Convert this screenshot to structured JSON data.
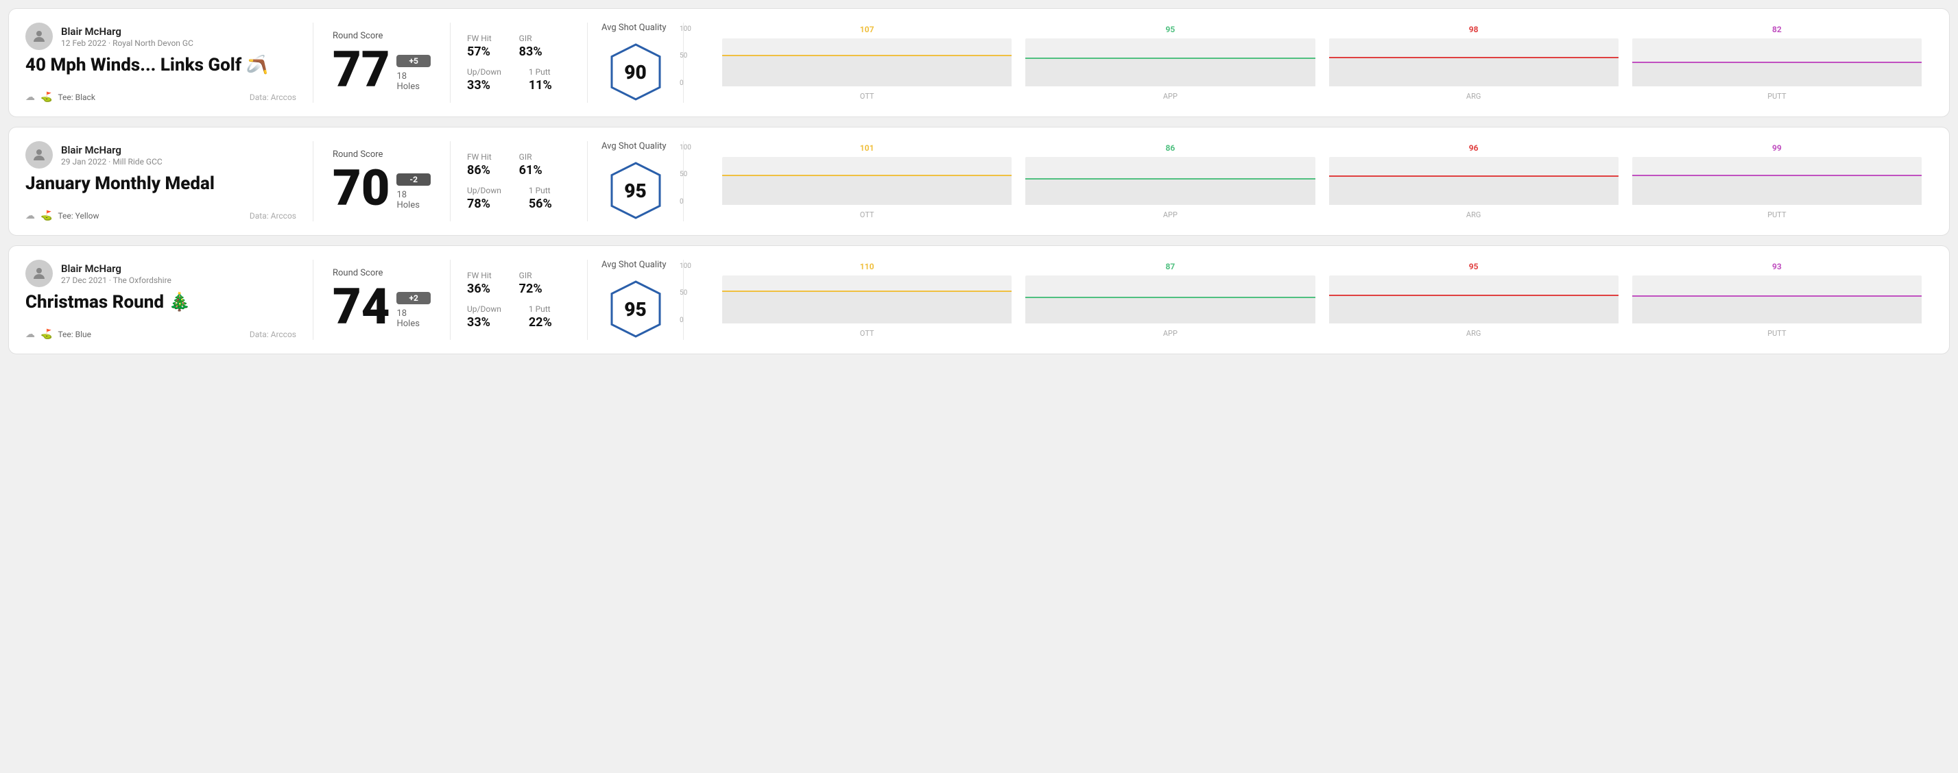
{
  "rounds": [
    {
      "id": "round1",
      "user": {
        "name": "Blair McHarg",
        "date": "12 Feb 2022",
        "venue": "Royal North Devon GC"
      },
      "title": "40 Mph Winds... Links Golf 🪃",
      "tee": "Black",
      "dataSource": "Data: Arccos",
      "score": {
        "label": "Round Score",
        "number": "77",
        "modifier": "+5",
        "modifierType": "positive",
        "holes": "18 Holes"
      },
      "stats": {
        "fwHit": {
          "label": "FW Hit",
          "value": "57%"
        },
        "gir": {
          "label": "GIR",
          "value": "83%"
        },
        "upDown": {
          "label": "Up/Down",
          "value": "33%"
        },
        "onePutt": {
          "label": "1 Putt",
          "value": "11%"
        }
      },
      "quality": {
        "label": "Avg Shot Quality",
        "score": "90"
      },
      "chart": {
        "bars": [
          {
            "label": "OTT",
            "value": 107,
            "color": "#f0c040",
            "pct": 65
          },
          {
            "label": "APP",
            "value": 95,
            "color": "#50c080",
            "pct": 60
          },
          {
            "label": "ARG",
            "value": 98,
            "color": "#e04040",
            "pct": 62
          },
          {
            "label": "PUTT",
            "value": 82,
            "color": "#c050c0",
            "pct": 52
          }
        ],
        "yLabels": [
          "100",
          "50",
          "0"
        ]
      }
    },
    {
      "id": "round2",
      "user": {
        "name": "Blair McHarg",
        "date": "29 Jan 2022",
        "venue": "Mill Ride GCC"
      },
      "title": "January Monthly Medal",
      "tee": "Yellow",
      "dataSource": "Data: Arccos",
      "score": {
        "label": "Round Score",
        "number": "70",
        "modifier": "-2",
        "modifierType": "negative",
        "holes": "18 Holes"
      },
      "stats": {
        "fwHit": {
          "label": "FW Hit",
          "value": "86%"
        },
        "gir": {
          "label": "GIR",
          "value": "61%"
        },
        "upDown": {
          "label": "Up/Down",
          "value": "78%"
        },
        "onePutt": {
          "label": "1 Putt",
          "value": "56%"
        }
      },
      "quality": {
        "label": "Avg Shot Quality",
        "score": "95"
      },
      "chart": {
        "bars": [
          {
            "label": "OTT",
            "value": 101,
            "color": "#f0c040",
            "pct": 63
          },
          {
            "label": "APP",
            "value": 86,
            "color": "#50c080",
            "pct": 55
          },
          {
            "label": "ARG",
            "value": 96,
            "color": "#e04040",
            "pct": 61
          },
          {
            "label": "PUTT",
            "value": 99,
            "color": "#c050c0",
            "pct": 63
          }
        ],
        "yLabels": [
          "100",
          "50",
          "0"
        ]
      }
    },
    {
      "id": "round3",
      "user": {
        "name": "Blair McHarg",
        "date": "27 Dec 2021",
        "venue": "The Oxfordshire"
      },
      "title": "Christmas Round 🎄",
      "tee": "Blue",
      "dataSource": "Data: Arccos",
      "score": {
        "label": "Round Score",
        "number": "74",
        "modifier": "+2",
        "modifierType": "positive",
        "holes": "18 Holes"
      },
      "stats": {
        "fwHit": {
          "label": "FW Hit",
          "value": "36%"
        },
        "gir": {
          "label": "GIR",
          "value": "72%"
        },
        "upDown": {
          "label": "Up/Down",
          "value": "33%"
        },
        "onePutt": {
          "label": "1 Putt",
          "value": "22%"
        }
      },
      "quality": {
        "label": "Avg Shot Quality",
        "score": "95"
      },
      "chart": {
        "bars": [
          {
            "label": "OTT",
            "value": 110,
            "color": "#f0c040",
            "pct": 68
          },
          {
            "label": "APP",
            "value": 87,
            "color": "#50c080",
            "pct": 55
          },
          {
            "label": "ARG",
            "value": 95,
            "color": "#e04040",
            "pct": 60
          },
          {
            "label": "PUTT",
            "value": 93,
            "color": "#c050c0",
            "pct": 59
          }
        ],
        "yLabels": [
          "100",
          "50",
          "0"
        ]
      }
    }
  ]
}
